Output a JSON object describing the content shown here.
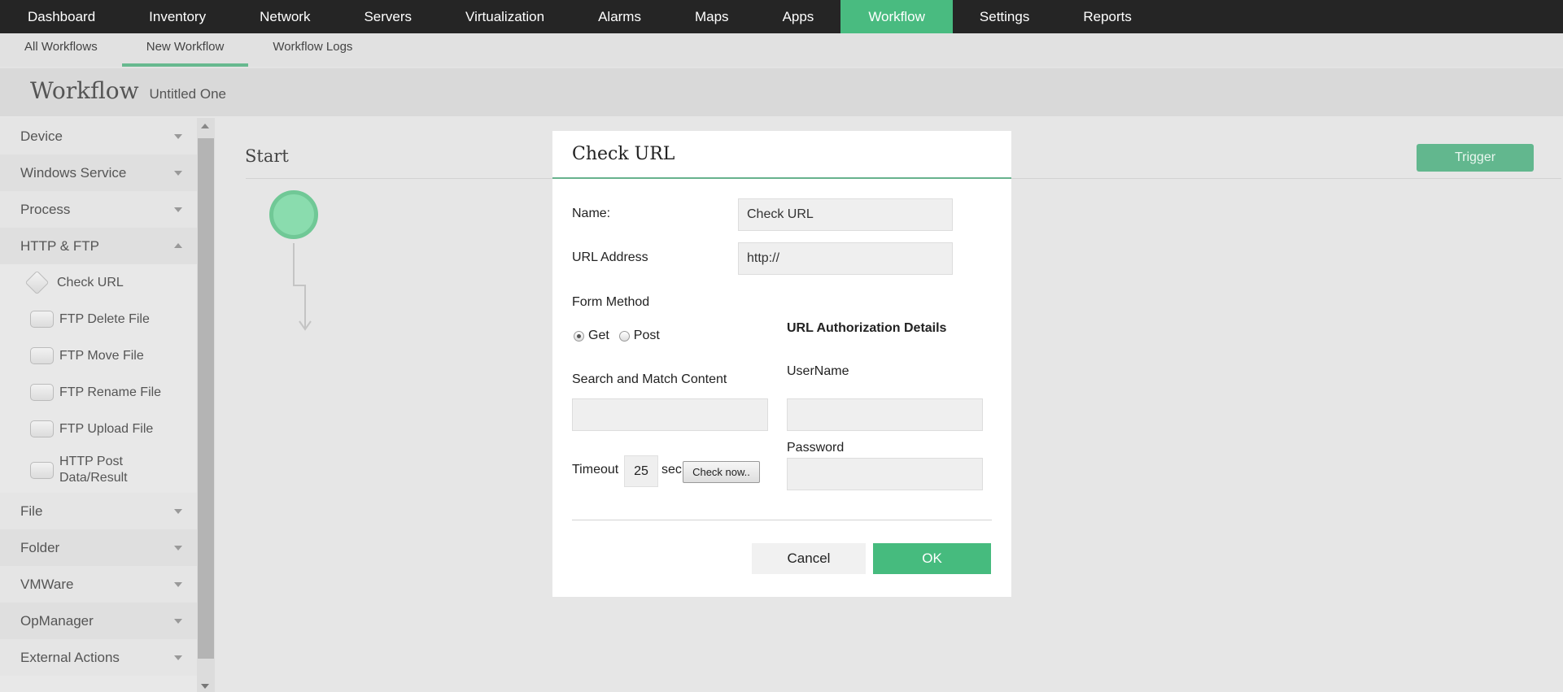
{
  "topnav": {
    "items": [
      {
        "label": "Dashboard"
      },
      {
        "label": "Inventory"
      },
      {
        "label": "Network"
      },
      {
        "label": "Servers"
      },
      {
        "label": "Virtualization"
      },
      {
        "label": "Alarms"
      },
      {
        "label": "Maps"
      },
      {
        "label": "Apps"
      },
      {
        "label": "Workflow",
        "active": true
      },
      {
        "label": "Settings"
      },
      {
        "label": "Reports"
      }
    ],
    "active_color": "#49bb80"
  },
  "subnav": {
    "items": [
      {
        "label": "All Workflows"
      },
      {
        "label": "New Workflow",
        "active": true
      },
      {
        "label": "Workflow Logs"
      }
    ]
  },
  "header": {
    "title": "Workflow",
    "subtitle": "Untitled One"
  },
  "sidebar": {
    "categories": [
      {
        "label": "Device",
        "expanded": false
      },
      {
        "label": "Windows Service",
        "expanded": false
      },
      {
        "label": "Process",
        "expanded": false
      },
      {
        "label": "HTTP & FTP",
        "expanded": true,
        "items": [
          {
            "label": "Check URL",
            "icon": "diamond-icon"
          },
          {
            "label": "FTP Delete File",
            "icon": "action-box-icon"
          },
          {
            "label": "FTP Move File",
            "icon": "action-box-icon"
          },
          {
            "label": "FTP Rename File",
            "icon": "action-box-icon"
          },
          {
            "label": "FTP Upload File",
            "icon": "action-box-icon"
          },
          {
            "label": "HTTP Post Data/Result",
            "icon": "action-box-icon"
          }
        ]
      },
      {
        "label": "File",
        "expanded": false
      },
      {
        "label": "Folder",
        "expanded": false
      },
      {
        "label": "VMWare",
        "expanded": false
      },
      {
        "label": "OpManager",
        "expanded": false
      },
      {
        "label": "External Actions",
        "expanded": false
      }
    ]
  },
  "canvas": {
    "start_label": "Start",
    "trigger_label": "Trigger",
    "start_node_color": "#8adcae"
  },
  "dialog": {
    "title": "Check URL",
    "name_label": "Name:",
    "name_value": "Check URL",
    "url_label": "URL Address",
    "url_value": "http://",
    "form_method_label": "Form Method",
    "methods": [
      {
        "label": "Get",
        "checked": true
      },
      {
        "label": "Post",
        "checked": false
      }
    ],
    "search_label": "Search and Match Content",
    "search_value": "",
    "timeout_label": "Timeout",
    "timeout_value": "25",
    "timeout_unit": "sec",
    "check_now_label": "Check now..",
    "auth_title": "URL Authorization Details",
    "username_label": "UserName",
    "username_value": "",
    "password_label": "Password",
    "password_value": "",
    "cancel_label": "Cancel",
    "ok_label": "OK",
    "accent_color": "#46bb7e"
  }
}
